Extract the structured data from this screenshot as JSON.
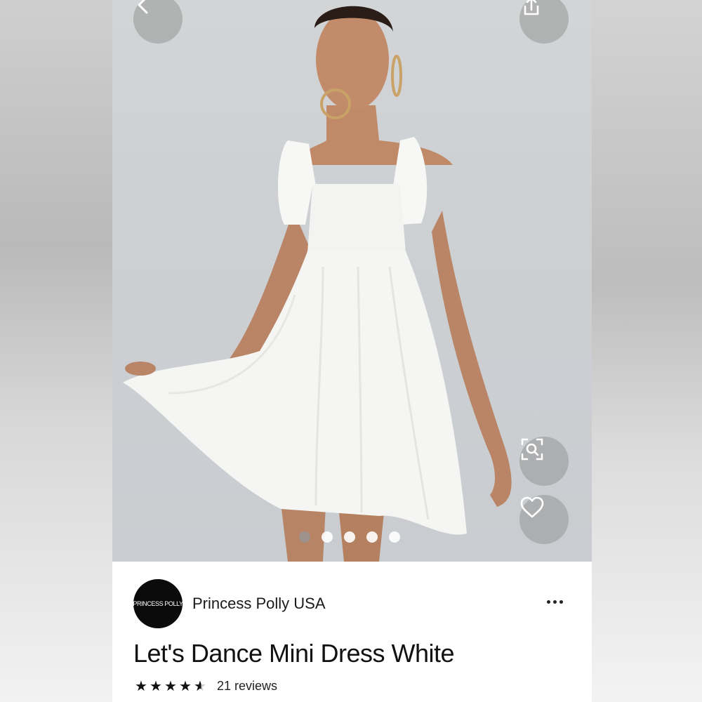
{
  "nav": {
    "back_icon": "chevron-left-icon",
    "share_icon": "share-icon"
  },
  "gallery": {
    "image_count": 5,
    "active_index": 0,
    "actions": {
      "visual_search_icon": "visual-search-icon",
      "save_icon": "heart-icon"
    }
  },
  "seller": {
    "logo_text": "PRINCESS POLLY",
    "name": "Princess Polly USA",
    "more_icon": "more-horizontal-icon"
  },
  "product": {
    "title": "Let's Dance Mini Dress White",
    "rating": 4.5,
    "rating_max": 5,
    "reviews_label": "21 reviews"
  },
  "colors": {
    "fab_bg": "#969696",
    "logo_bg": "#0b0b0b",
    "text": "#111111"
  }
}
